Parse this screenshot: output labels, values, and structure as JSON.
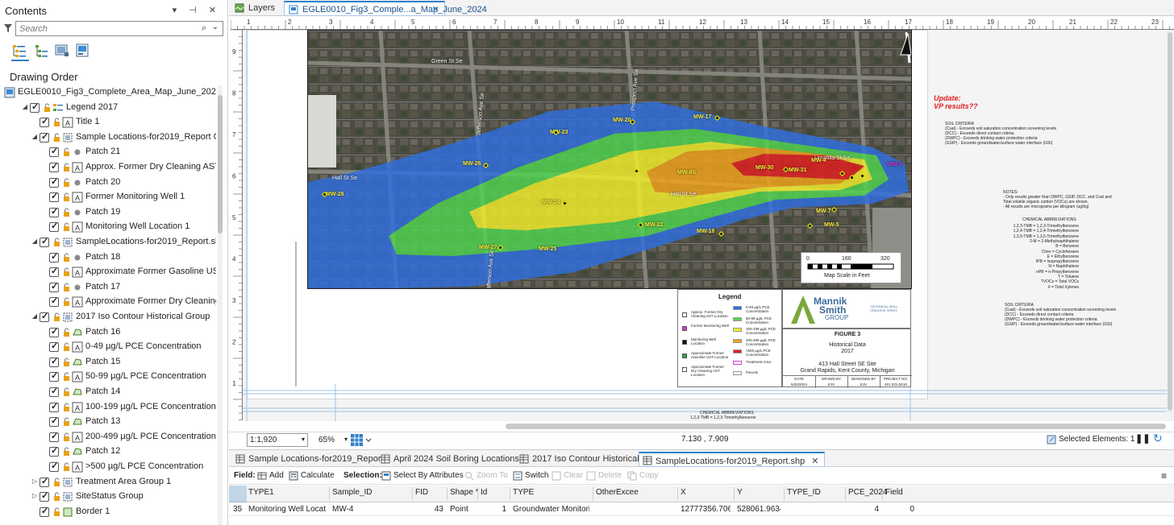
{
  "contents": {
    "title": "Contents",
    "controls": "▾ ⊣ ✕",
    "search_placeholder": "Search",
    "drawing_order": "Drawing Order",
    "tree": [
      {
        "level": 0,
        "expander": "",
        "check": false,
        "label": "EGLE0010_Fig3_Complete_Area_Map_June_2024",
        "icon": "map-icon"
      },
      {
        "level": 1,
        "expander": "◢",
        "check": true,
        "label": "Legend 2017",
        "icon": "legend-icon"
      },
      {
        "level": 2,
        "expander": "",
        "check": true,
        "label": "Title 1",
        "icon": "text-icon"
      },
      {
        "level": 2,
        "expander": "◢",
        "check": true,
        "label": "Sample Locations-for2019_Report Group 1",
        "icon": "group-icon"
      },
      {
        "level": 3,
        "expander": "",
        "check": true,
        "label": "Patch 21",
        "icon": "point-icon"
      },
      {
        "level": 3,
        "expander": "",
        "check": true,
        "label": "Approx. Former Dry Cleaning AST Loc...",
        "icon": "text-icon"
      },
      {
        "level": 3,
        "expander": "",
        "check": true,
        "label": "Patch 20",
        "icon": "point-icon"
      },
      {
        "level": 3,
        "expander": "",
        "check": true,
        "label": "Former Monitoring Well 1",
        "icon": "text-icon"
      },
      {
        "level": 3,
        "expander": "",
        "check": true,
        "label": "Patch 19",
        "icon": "point-icon"
      },
      {
        "level": 3,
        "expander": "",
        "check": true,
        "label": "Monitoring Well Location 1",
        "icon": "text-icon"
      },
      {
        "level": 2,
        "expander": "◢",
        "check": true,
        "label": "SampleLocations-for2019_Report.shp Gro...",
        "icon": "group-icon"
      },
      {
        "level": 3,
        "expander": "",
        "check": true,
        "label": "Patch 18",
        "icon": "point-icon"
      },
      {
        "level": 3,
        "expander": "",
        "check": true,
        "label": "Approximate Former Gasoline UST Loc...",
        "icon": "text-icon"
      },
      {
        "level": 3,
        "expander": "",
        "check": true,
        "label": "Patch 17",
        "icon": "point-icon"
      },
      {
        "level": 3,
        "expander": "",
        "check": true,
        "label": "Approximate Former Dry Cleaning AS...",
        "icon": "text-icon"
      },
      {
        "level": 2,
        "expander": "◢",
        "check": true,
        "label": "2017 Iso Contour Historical  Group",
        "icon": "group-icon"
      },
      {
        "level": 3,
        "expander": "",
        "check": true,
        "label": "Patch 16",
        "icon": "polygon-icon"
      },
      {
        "level": 3,
        "expander": "",
        "check": true,
        "label": "0-49  µg/L PCE Concentration",
        "icon": "text-icon"
      },
      {
        "level": 3,
        "expander": "",
        "check": true,
        "label": "Patch 15",
        "icon": "polygon-icon"
      },
      {
        "level": 3,
        "expander": "",
        "check": true,
        "label": "50-99  µg/L PCE Concentration",
        "icon": "text-icon"
      },
      {
        "level": 3,
        "expander": "",
        "check": true,
        "label": "Patch 14",
        "icon": "polygon-icon"
      },
      {
        "level": 3,
        "expander": "",
        "check": true,
        "label": "100-199  µg/L PCE Concentration",
        "icon": "text-icon"
      },
      {
        "level": 3,
        "expander": "",
        "check": true,
        "label": "Patch 13",
        "icon": "polygon-icon"
      },
      {
        "level": 3,
        "expander": "",
        "check": true,
        "label": "200-499  µg/L PCE Concentration",
        "icon": "text-icon"
      },
      {
        "level": 3,
        "expander": "",
        "check": true,
        "label": "Patch 12",
        "icon": "polygon-icon"
      },
      {
        "level": 3,
        "expander": "",
        "check": true,
        "label": ">500  µg/L PCE Concentration",
        "icon": "text-icon"
      },
      {
        "level": 2,
        "expander": "▷",
        "check": true,
        "label": "Treatment  Area Group 1",
        "icon": "group-icon"
      },
      {
        "level": 2,
        "expander": "▷",
        "check": true,
        "label": "SiteStatus Group",
        "icon": "group-icon"
      },
      {
        "level": 2,
        "expander": "",
        "check": true,
        "label": "Border 1",
        "icon": "rect-icon"
      }
    ]
  },
  "tabs": {
    "layers": "Layers",
    "map": "EGLE0010_Fig3_Comple...a_Map_June_2024",
    "close": "✕"
  },
  "map": {
    "wells": [
      "MW-23",
      "MW-20",
      "MW-17",
      "MW-26",
      "MW-4",
      "MW-30",
      "MW-31",
      "MW-8S",
      "MW-28",
      "MW-24",
      "MW-22",
      "MW-7",
      "MW-5",
      "MW-18",
      "MW-27",
      "MW-25",
      "MW-3"
    ],
    "streets": [
      "Green St Se",
      "Hall St Se",
      "Hall St Se",
      "Jefferson Ave Se",
      "Prospect Ave Se",
      "Jefferson Ave Se",
      "Lafayette Ave Se",
      "Umatilla St Se"
    ],
    "scale_ticks": [
      "0",
      "160",
      "320"
    ],
    "scale_label": "Map Scale in Feet",
    "north": "N"
  },
  "legend": {
    "title": "Legend",
    "left_items": [
      "Approx. Former Dry Cleaning AST Location",
      "Former Monitoring Well",
      "Monitoring Well Location",
      "Approximate Former Gasoline UST Location",
      "Approximate Former Dry Cleaning AST Location"
    ],
    "right_items": [
      "0-49 µg/L PCE Concentration",
      "50-99 µg/L PCE Concentration",
      "100-199 µg/L PCE Concentration",
      "200-499 µg/L PCE Concentration",
      ">500 µg/L PCE Concentration",
      "Treatment Area",
      "Parcels"
    ],
    "colors": [
      "#2f6fe0",
      "#4fd44f",
      "#f3ef2a",
      "#f2a21a",
      "#e21e1e",
      "#d63bd6",
      "#ffffff"
    ]
  },
  "title_block": {
    "company1": "Mannik",
    "company2": "Smith",
    "company3": "GROUP",
    "tagline": "TECHNICAL SKILL. CREATIVE SPIRIT.",
    "figure": "FIGURE 3",
    "subtitle1": "Historical Data",
    "subtitle2": "2017",
    "site1": "413 Hall Street SE Site",
    "site2": "Grand Rapids, Kent County, Michigan",
    "cols": [
      "DATE",
      "DRAWN BY",
      "DESIGNED BY",
      "PROJECT NO."
    ],
    "vals": [
      "5/20/2024",
      "EJV",
      "EJV",
      "401 EGL0010"
    ]
  },
  "notes": {
    "update1": "Update:",
    "update2": "VP results??",
    "soil_criteria_title": "SOIL CRITERIA",
    "soil_criteria": [
      "(Csat) - Exceeds soil saturation concentration screening levels",
      "(DCC) - Exceeds direct contact criteria",
      "(DWPC) - Exceeds drinking water protection criteria",
      "(GSIP) - Exceeds groundwater/surface water interface (GSI)"
    ],
    "notes_title": "NOTES:",
    "notes": [
      "- Only results greater than DWPC, GSIP, DCC, and Csat and",
      "Total volatile organic carbon (VOCs) are shown.",
      "- All results are micrograms per kilogram (ug/kg)"
    ],
    "chem_title": "CHEMICAL ABBREVIATIONS",
    "chem": [
      "1,2,3-TMB = 1,2,3-Trimethylbenzene",
      "1,2,4-TMB = 1,2,4-Trimethylbenzene",
      "1,3,5-TMB = 1,3,5-Trimethylbenzene",
      "2-M = 2-Methylnaphthalene",
      "B = Benzene",
      "Chex = Cyclohexane",
      "E = Ethylbenzene",
      "IPB = Isopropylbenzene",
      "N = Naphthalene",
      "nPB = n-Propylbenzene",
      "T = Toluene",
      "TVOCs = Total VOCs",
      "X = Total Xylenes"
    ],
    "soil2_title": "SOIL CRITERIA",
    "soil2": [
      "(Csat) - Exceeds soil saturation concentration screening levels",
      "(DCC) - Exceeds direct contact criteria",
      "(DWPC) - Exceeds drinking water protection criteria",
      "(GSIP) - Exceeds groundwater/surface water interface (GSI)"
    ],
    "bottom1": "CHEMICAL ABBREVIATIONS",
    "bottom2": "1,2,3-TMB = 1,2,3-Trimethylbenzene"
  },
  "ruler_top": [
    "1",
    "2",
    "3",
    "4",
    "5",
    "6",
    "7",
    "8",
    "9",
    "10",
    "11",
    "12",
    "13",
    "14",
    "15",
    "16",
    "17",
    "18",
    "19",
    "20",
    "21",
    "22",
    "23"
  ],
  "ruler_left": [
    "9",
    "8",
    "7",
    "6",
    "5",
    "4",
    "3",
    "2",
    "1",
    "0"
  ],
  "status": {
    "scale": "1:1,920",
    "zoom": "65%",
    "coords": "7.130 , 7.909",
    "selected": "Selected Elements: 1"
  },
  "bottom_tabs": [
    "Sample Locations-for2019_Report",
    "April 2024 Soil Boring Locations",
    "2017 Iso Contour Historical",
    "SampleLocations-for2019_Report.shp"
  ],
  "table_toolbar": {
    "field": "Field:",
    "add": "Add",
    "calculate": "Calculate",
    "selection": "Selection:",
    "select_by_attr": "Select By Attributes",
    "zoom_to": "Zoom To",
    "switch": "Switch",
    "clear": "Clear",
    "delete": "Delete",
    "copy": "Copy"
  },
  "table": {
    "columns": [
      "TYPE1",
      "Sample_ID",
      "FID",
      "Shape *",
      "Id",
      "TYPE",
      "OtherExcee",
      "X",
      "Y",
      "TYPE_ID",
      "PCE_2024",
      "Field"
    ],
    "row": {
      "num": "35",
      "cells": [
        "Monitoring Well Location",
        "MW-4",
        "43",
        "Point",
        "1",
        "Groundwater Monitorin...",
        "",
        "12777356.7061",
        "528061.96342",
        "",
        "4",
        "0"
      ]
    }
  }
}
